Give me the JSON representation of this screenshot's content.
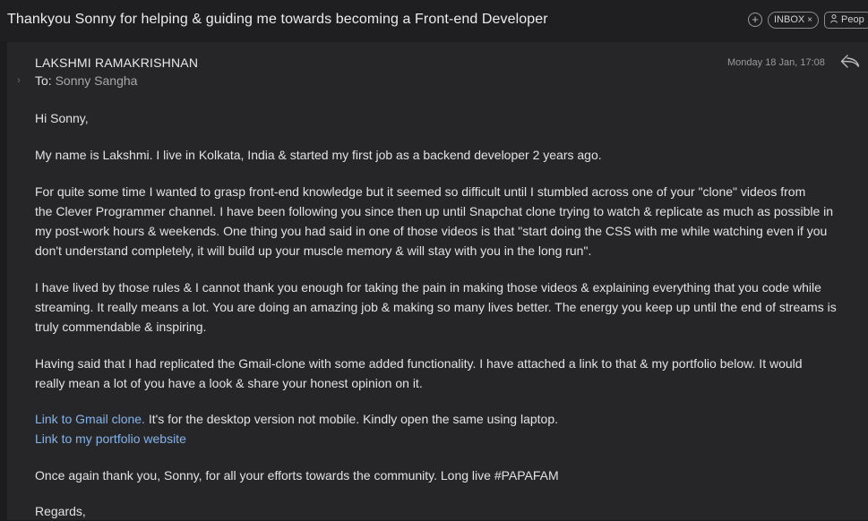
{
  "header": {
    "subject": "Thankyou Sonny for helping & guiding me towards becoming a Front-end Developer",
    "add_icon": "plus-circle-icon",
    "label_chip": "INBOX",
    "label_remove_icon": "close-icon",
    "people_chip": "Peop"
  },
  "message": {
    "sender": "LAKSHMI RAMAKRISHNAN",
    "to_label": "To:",
    "to_name": "Sonny Sangha",
    "date": "Monday 18 Jan, 17:08",
    "reply_icon": "reply-icon",
    "expand_icon": "chevron-right-icon"
  },
  "body": {
    "greeting": "Hi Sonny,",
    "p1": "My name is Lakshmi. I live in Kolkata, India & started my first job as a backend developer 2 years ago.",
    "p2_lines": [
      "For quite some time I wanted to grasp front-end knowledge but it seemed so difficult until I stumbled across one of your \"clone\" videos from",
      "the Clever Programmer channel. I have been following you since then up until Snapchat clone trying to watch & replicate as much as possible in",
      "my post-work hours & weekends. One thing you had said in one of those videos is that \"start doing the CSS with me while watching even if you",
      "don't understand completely, it will build up your muscle memory & will stay with you in the long run\"."
    ],
    "p3_lines": [
      "I have lived by those rules & I cannot thank you enough for taking the pain in making those videos & explaining everything that you code while",
      "streaming. It really means a lot. You are doing an amazing job & making so many lives better. The energy you keep up until the end of streams is",
      "truly commendable & inspiring."
    ],
    "p4_lines": [
      "Having said that I had replicated the Gmail-clone with some added functionality. I have attached a link to that & my portfolio below. It would",
      "really mean a lot of you have a look & share your honest opinion on it."
    ],
    "link1": "Link to Gmail clone.",
    "link1_note": " It's for the desktop version not mobile. Kindly open the same using laptop.",
    "link2": "Link to my portfolio website",
    "p5": "Once again thank you, Sonny, for all your efforts towards the community. Long live #PAPAFAM",
    "closing": "Regards,"
  }
}
